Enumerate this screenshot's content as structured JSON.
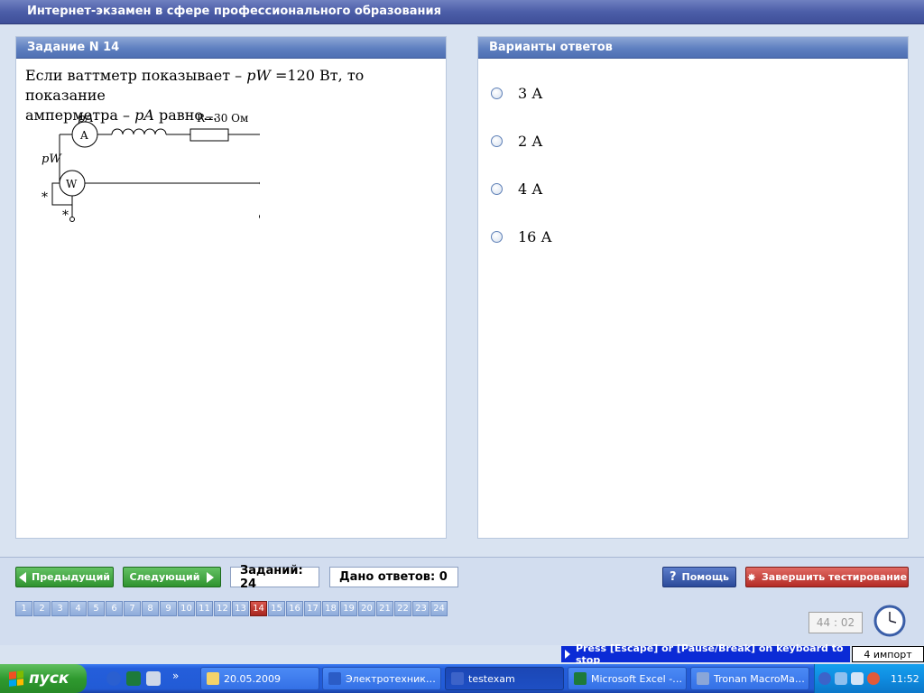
{
  "window": {
    "title": "Интернет-экзамен в сфере профессионального образования"
  },
  "question": {
    "header": "Задание N 14",
    "line1_a": "Если ваттметр показывает – ",
    "line1_var": "pW",
    "line1_b": " =120  Вт, то показание",
    "line2_a": "амперметра  – ",
    "line2_var": "pA",
    "line2_b": " равно…",
    "circuit": {
      "ammeter_label": "pA",
      "ammeter_symbol": "A",
      "resistor_label": "R=30 Ом",
      "wattmeter_label": "pW",
      "wattmeter_symbol": "W",
      "star1": "*",
      "star2": "*"
    }
  },
  "answers": {
    "header": "Варианты ответов",
    "options": [
      "3 А",
      "2 А",
      "4 А",
      "16 А"
    ]
  },
  "toolbar": {
    "prev_label": "Предыдущий",
    "next_label": "Следующий",
    "total_tasks": "Заданий: 24",
    "answered": "Дано ответов: 0",
    "help_label": "Помощь",
    "help_glyph": "?",
    "finish_label": "Завершить тестирование",
    "finish_glyph": "✸"
  },
  "question_nav": {
    "numbers": [
      "1",
      "2",
      "3",
      "4",
      "5",
      "6",
      "7",
      "8",
      "9",
      "10",
      "11",
      "12",
      "13",
      "14",
      "15",
      "16",
      "17",
      "18",
      "19",
      "20",
      "21",
      "22",
      "23",
      "24"
    ],
    "current": "14"
  },
  "timer": "44 : 02",
  "hint": "Press [Escape] or [Pause/Break] on keyboard to stop",
  "keyboard_layout": "4 импорт",
  "taskbar": {
    "start_label": "пуск",
    "chevron": "»",
    "tasks": [
      {
        "label": "20.05.2009",
        "color": "#f3d36b"
      },
      {
        "label": "Электротехник…",
        "color": "#2b5cc6"
      },
      {
        "label": "testexam",
        "color": "#3c63c9"
      },
      {
        "label": "Microsoft Excel -…",
        "color": "#1d7a3a"
      },
      {
        "label": "Tronan MacroMa…",
        "color": "#8aa6d8"
      }
    ],
    "active_task": "testexam",
    "clock": "11:52"
  },
  "colors": {
    "accent": "#4f70b3",
    "current_question": "#a8261f",
    "hint_bg": "#0b2bd6"
  }
}
